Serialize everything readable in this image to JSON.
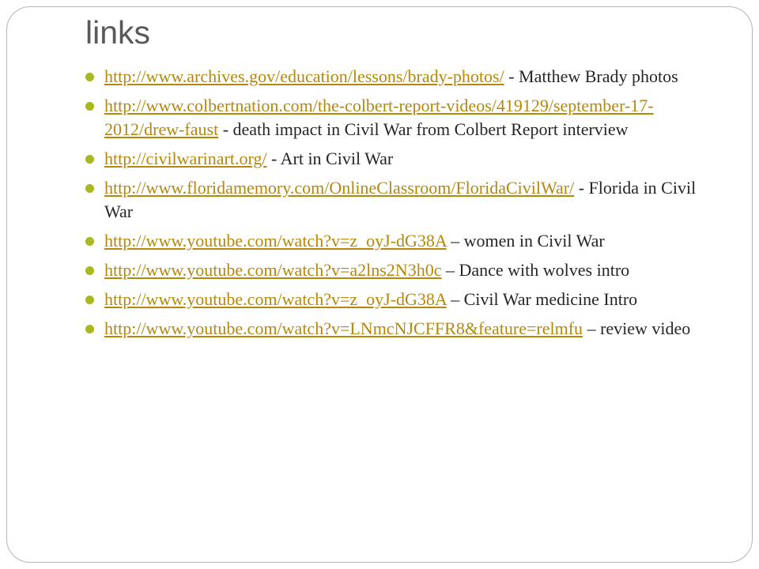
{
  "slide": {
    "title": "links",
    "accent_color": "#a9b820",
    "link_color": "#b5880c",
    "items": [
      {
        "url": "http://www.archives.gov/education/lessons/brady-photos/",
        "desc": " - Matthew Brady photos"
      },
      {
        "url": "http://www.colbertnation.com/the-colbert-report-videos/419129/september-17-2012/drew-faust",
        "desc": " - death impact in Civil War from Colbert Report interview"
      },
      {
        "url": "http://civilwarinart.org/",
        "desc": " - Art in Civil War"
      },
      {
        "url": "http://www.floridamemory.com/OnlineClassroom/FloridaCivilWar/",
        "desc": " - Florida in Civil War"
      },
      {
        "url": "http://www.youtube.com/watch?v=z_oyJ-dG38A",
        "desc": " – women in Civil War"
      },
      {
        "url": "http://www.youtube.com/watch?v=a2lns2N3h0c",
        "desc": " – Dance with wolves intro"
      },
      {
        "url": "http://www.youtube.com/watch?v=z_oyJ-dG38A",
        "desc": " – Civil War medicine Intro"
      },
      {
        "url": "http://www.youtube.com/watch?v=LNmcNJCFFR8&feature=relmfu",
        "desc": " – review video"
      }
    ]
  }
}
